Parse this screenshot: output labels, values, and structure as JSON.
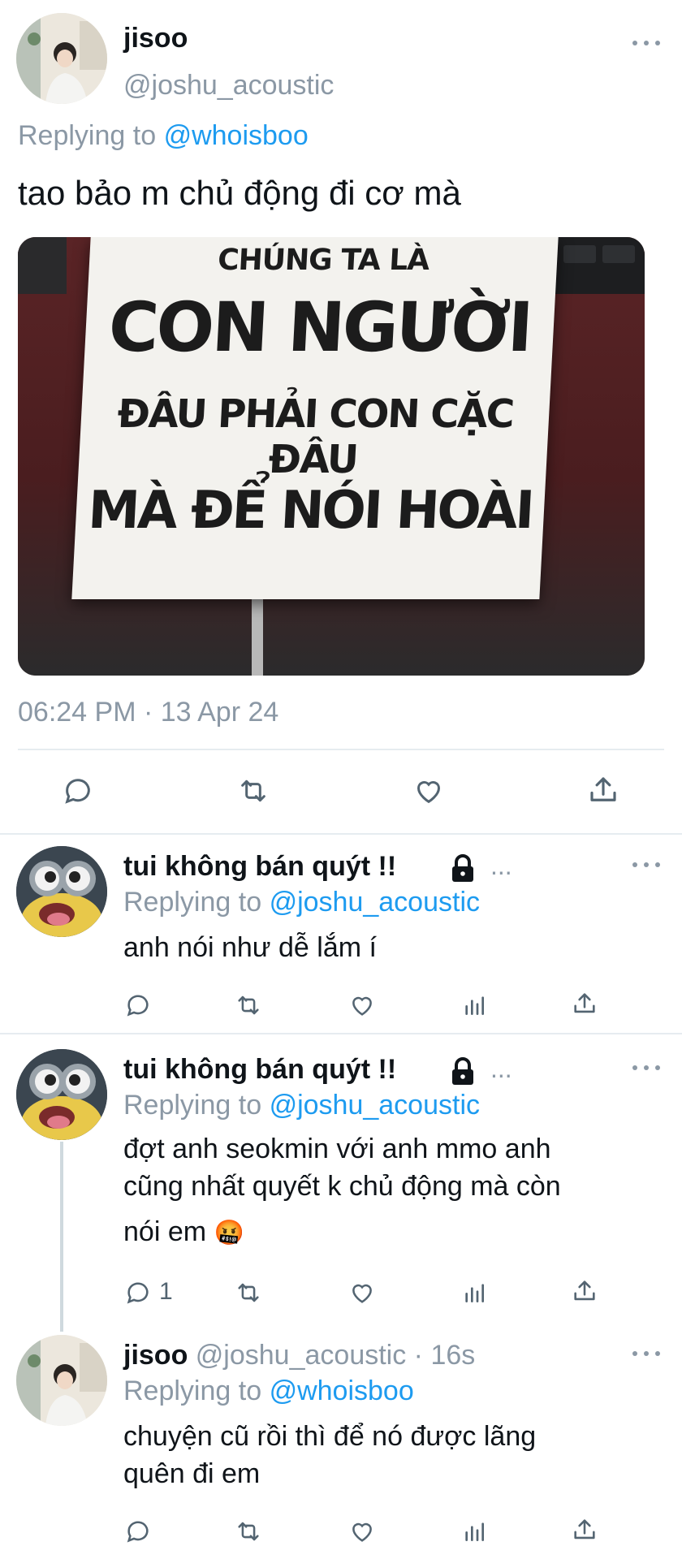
{
  "main_tweet": {
    "display_name": "jisoo",
    "handle": "@joshu_acoustic",
    "replying_prefix": "Replying to",
    "replying_to": "@whoisboo",
    "text": "tao bảo m chủ động đi cơ mà",
    "image_text": {
      "line1": "CHÚNG TA LÀ",
      "line2": "CON NGƯỜI",
      "line3": "ĐÂU PHẢI CON CẶC ĐÂU",
      "line4": "MÀ ĐỂ NÓI HOÀI"
    },
    "timestamp": "06:24 PM · 13 Apr 24"
  },
  "replies": [
    {
      "display_name": "tui không bán quýt !!",
      "ellipsis": "...",
      "replying_prefix": "Replying to",
      "replying_to": "@joshu_acoustic",
      "text": "anh nói như dễ lắm í",
      "reply_count": ""
    },
    {
      "display_name": "tui không bán quýt !!",
      "ellipsis": "...",
      "replying_prefix": "Replying to",
      "replying_to": "@joshu_acoustic",
      "text_line1": "đợt anh seokmin với anh mmo anh",
      "text_line2": "cũng nhất quyết k chủ động mà còn",
      "text_line3": "nói em",
      "emoji": "🤬",
      "reply_count": "1"
    },
    {
      "display_name": "jisoo",
      "handle_time": "@joshu_acoustic · 16s",
      "replying_prefix": "Replying to",
      "replying_to": "@whoisboo",
      "text_line1": "chuyện cũ rồi thì để nó được lãng",
      "text_line2": "quên đi em"
    }
  ],
  "icons": [
    "reply-icon",
    "retweet-icon",
    "like-icon",
    "views-icon",
    "share-icon",
    "lock-icon",
    "more-icon"
  ],
  "colors": {
    "link": "#1d9bf0",
    "muted": "#8b98a5",
    "icon": "#536471"
  }
}
